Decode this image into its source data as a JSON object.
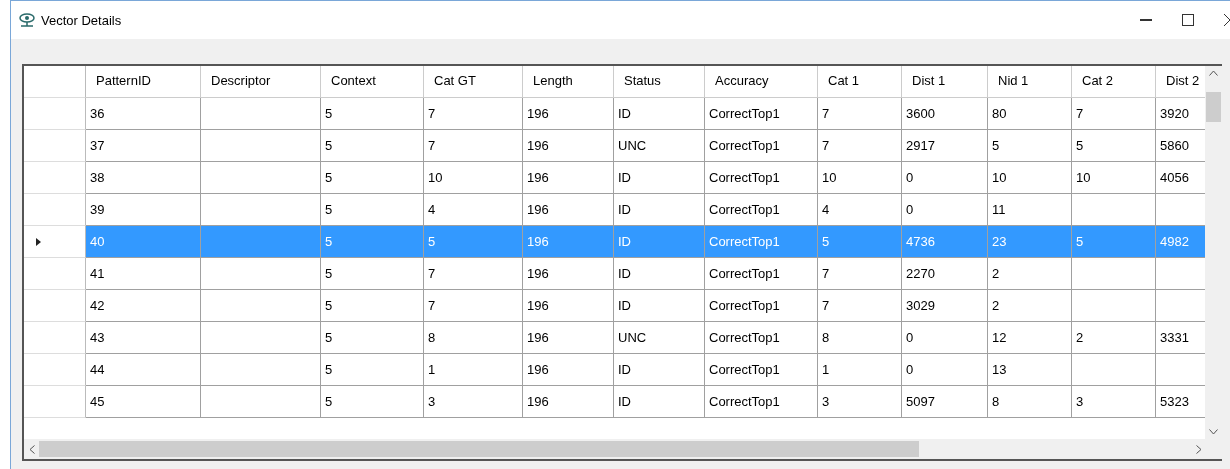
{
  "window": {
    "title": "Vector Details"
  },
  "table": {
    "columns": [
      "PatternID",
      "Descriptor",
      "Context",
      "Cat GT",
      "Length",
      "Status",
      "Accuracy",
      "Cat 1",
      "Dist 1",
      "Nid 1",
      "Cat 2",
      "Dist 2"
    ],
    "rows": [
      {
        "selected": false,
        "cells": [
          "36",
          "",
          "5",
          "7",
          "196",
          "ID",
          "CorrectTop1",
          "7",
          "3600",
          "80",
          "7",
          "3920"
        ]
      },
      {
        "selected": false,
        "cells": [
          "37",
          "",
          "5",
          "7",
          "196",
          "UNC",
          "CorrectTop1",
          "7",
          "2917",
          "5",
          "5",
          "5860"
        ]
      },
      {
        "selected": false,
        "cells": [
          "38",
          "",
          "5",
          "10",
          "196",
          "ID",
          "CorrectTop1",
          "10",
          "0",
          "10",
          "10",
          "4056"
        ]
      },
      {
        "selected": false,
        "cells": [
          "39",
          "",
          "5",
          "4",
          "196",
          "ID",
          "CorrectTop1",
          "4",
          "0",
          "11",
          "",
          ""
        ]
      },
      {
        "selected": true,
        "cells": [
          "40",
          "",
          "5",
          "5",
          "196",
          "ID",
          "CorrectTop1",
          "5",
          "4736",
          "23",
          "5",
          "4982"
        ]
      },
      {
        "selected": false,
        "cells": [
          "41",
          "",
          "5",
          "7",
          "196",
          "ID",
          "CorrectTop1",
          "7",
          "2270",
          "2",
          "",
          ""
        ]
      },
      {
        "selected": false,
        "cells": [
          "42",
          "",
          "5",
          "7",
          "196",
          "ID",
          "CorrectTop1",
          "7",
          "3029",
          "2",
          "",
          ""
        ]
      },
      {
        "selected": false,
        "cells": [
          "43",
          "",
          "5",
          "8",
          "196",
          "UNC",
          "CorrectTop1",
          "8",
          "0",
          "12",
          "2",
          "3331"
        ]
      },
      {
        "selected": false,
        "cells": [
          "44",
          "",
          "5",
          "1",
          "196",
          "ID",
          "CorrectTop1",
          "1",
          "0",
          "13",
          "",
          ""
        ]
      },
      {
        "selected": false,
        "cells": [
          "45",
          "",
          "5",
          "3",
          "196",
          "ID",
          "CorrectTop1",
          "3",
          "5097",
          "8",
          "3",
          "5323"
        ]
      }
    ]
  }
}
